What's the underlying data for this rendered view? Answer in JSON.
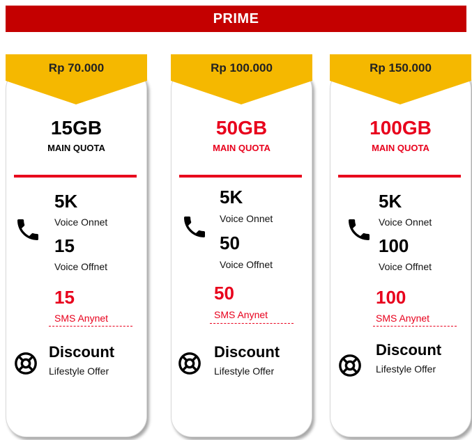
{
  "header": {
    "title": "PRIME"
  },
  "colors": {
    "header_bg": "#c40000",
    "tag": "#f5b800",
    "accent": "#e8001c"
  },
  "plans": [
    {
      "price": "Rp 70.000",
      "quota": "15GB",
      "quota_label": "MAIN QUOTA",
      "quota_highlight": false,
      "voice_onnet_value": "5K",
      "voice_onnet_label": "Voice Onnet",
      "voice_offnet_value": "15",
      "voice_offnet_label": "Voice Offnet",
      "sms_value": "15",
      "sms_label": "SMS Anynet",
      "discount_title": "Discount",
      "discount_label": "Lifestyle Offer",
      "icons": [
        "phone-icon",
        "lifebuoy-icon"
      ]
    },
    {
      "price": "Rp 100.000",
      "quota": "50GB",
      "quota_label": "MAIN QUOTA",
      "quota_highlight": true,
      "voice_onnet_value": "5K",
      "voice_onnet_label": "Voice Onnet",
      "voice_offnet_value": "50",
      "voice_offnet_label": "Voice Offnet",
      "sms_value": "50",
      "sms_label": "SMS Anynet",
      "discount_title": "Discount",
      "discount_label": "Lifestyle Offer",
      "icons": [
        "phone-icon",
        "lifebuoy-icon"
      ]
    },
    {
      "price": "Rp 150.000",
      "quota": "100GB",
      "quota_label": "MAIN QUOTA",
      "quota_highlight": true,
      "voice_onnet_value": "5K",
      "voice_onnet_label": "Voice Onnet",
      "voice_offnet_value": "100",
      "voice_offnet_label": "Voice Offnet",
      "sms_value": "100",
      "sms_label": "SMS Anynet",
      "discount_title": "Discount",
      "discount_label": "Lifestyle Offer",
      "icons": [
        "phone-icon",
        "lifebuoy-icon"
      ]
    }
  ]
}
